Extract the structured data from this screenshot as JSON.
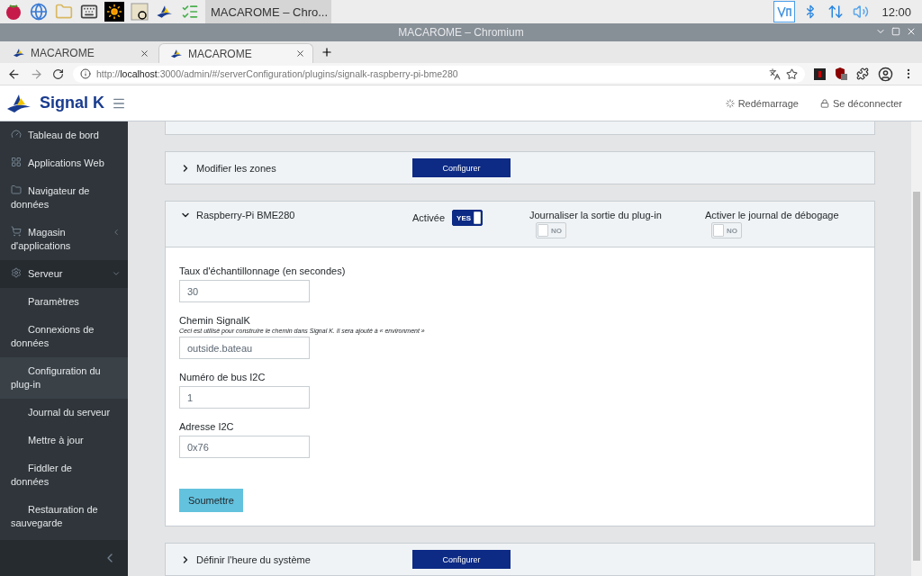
{
  "taskbar": {
    "window_button": "MACAROME – Chro...",
    "clock": "12:00"
  },
  "window": {
    "title": "MACAROME – Chromium"
  },
  "browser": {
    "tabs": [
      {
        "title": "MACAROME",
        "selected": false
      },
      {
        "title": "MACAROME",
        "selected": true
      }
    ],
    "url": {
      "scheme": "http://",
      "host": "localhost",
      "rest": ":3000/admin/#/serverConfiguration/plugins/signalk-raspberry-pi-bme280"
    }
  },
  "header": {
    "brand": "Signal K",
    "actions": [
      {
        "label": "Redémarrage",
        "kind": "restart"
      },
      {
        "label": "Se déconnecter",
        "kind": "logout"
      }
    ]
  },
  "sidebar": {
    "items": [
      {
        "label": "Tableau de bord",
        "selected": false
      },
      {
        "label": "Applications Web",
        "selected": false
      },
      {
        "label": "Navigateur de données",
        "selected": false
      },
      {
        "label": "Magasin d'applications",
        "selected": false,
        "expanded": false
      },
      {
        "label": "Serveur",
        "selected": false,
        "expanded": true,
        "children": [
          {
            "label": "Paramètres",
            "selected": false
          },
          {
            "label": "Connexions de données",
            "selected": false
          },
          {
            "label": "Configuration du plug-in",
            "selected": true
          },
          {
            "label": "Journal du serveur",
            "selected": false
          },
          {
            "label": "Mettre à jour",
            "selected": false
          },
          {
            "label": "Fiddler de données",
            "selected": false
          },
          {
            "label": "Restauration de sauvegarde",
            "selected": false
          }
        ]
      }
    ]
  },
  "plugins": [
    {
      "title": "Modifier les zones",
      "expanded": false,
      "button": "Configurer"
    },
    {
      "title": "Raspberry-Pi BME280",
      "expanded": true,
      "toggles": [
        {
          "label": "Activée",
          "on": true,
          "text": "YES"
        },
        {
          "label": "Journaliser la sortie du plug-in",
          "on": false,
          "text": "NO"
        },
        {
          "label": "Activer le journal de débogage",
          "on": false,
          "text": "NO"
        }
      ],
      "fields": [
        {
          "label": "Taux d'échantillonnage (en secondes)",
          "value": "30"
        },
        {
          "label": "Chemin SignalK",
          "hint": "Ceci est utilisé pour construire le chemin dans Signal K. Il sera ajouté à « environment »",
          "value": "outside.bateau"
        },
        {
          "label": "Numéro de bus I2C",
          "value": "1"
        },
        {
          "label": "Adresse I2C",
          "value": "0x76"
        }
      ],
      "submit": "Soumettre"
    },
    {
      "title": "Définir l'heure du système",
      "expanded": false,
      "button": "Configurer"
    }
  ]
}
